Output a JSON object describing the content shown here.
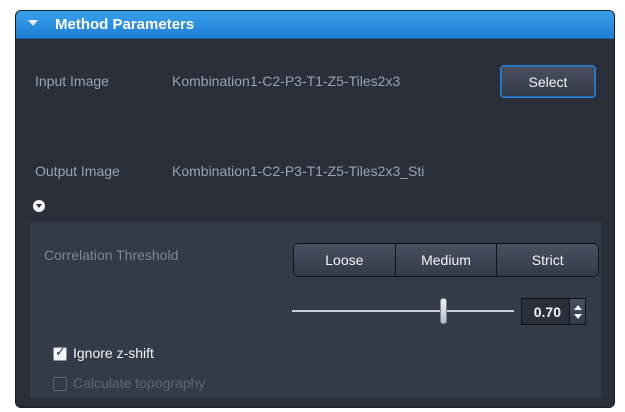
{
  "panel": {
    "header": {
      "title": "Method Parameters",
      "accent": "#2b8fe3",
      "toggle_icon": "chevron-down-icon"
    },
    "input_image": {
      "label": "Input Image",
      "value": "Kombination1-C2-P3-T1-Z5-Tiles2x3",
      "button_label": "Select"
    },
    "output_image": {
      "label": "Output Image",
      "value": "Kombination1-C2-P3-T1-Z5-Tiles2x3_Sti"
    },
    "expand_icon": "circle-chevron-down-icon",
    "correlation": {
      "label": "Correlation Threshold",
      "options": [
        "Loose",
        "Medium",
        "Strict"
      ],
      "slider_value": 0.7,
      "value_text": "0.70"
    },
    "checkboxes": [
      {
        "label": "Ignore z-shift",
        "checked": true
      },
      {
        "label": "Calculate topography",
        "checked": false
      }
    ]
  }
}
